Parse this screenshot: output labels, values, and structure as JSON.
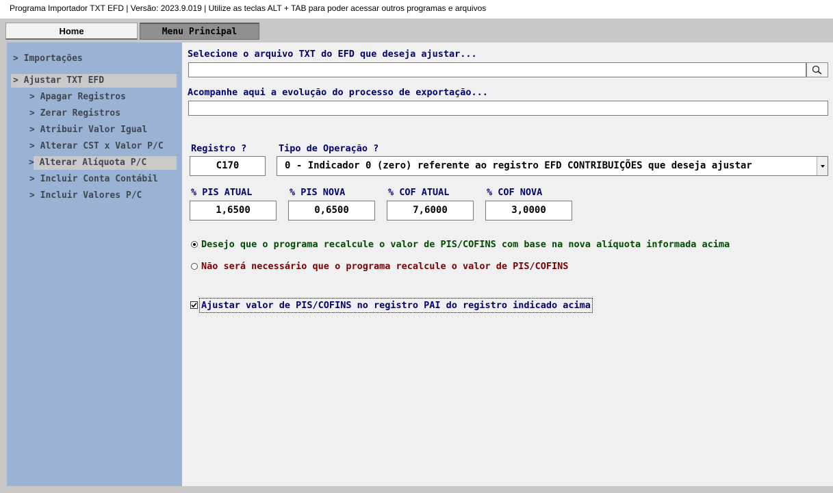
{
  "titlebar": {
    "text": "Programa Importador TXT EFD   |   Versão: 2023.9.019   |   Utilize as teclas ALT + TAB para poder acessar outros programas e arquivos"
  },
  "tabs": {
    "home": "Home",
    "menu": "Menu Principal"
  },
  "sidebar": {
    "items": [
      {
        "label": "> Importações",
        "highlighted": false
      },
      {
        "label": "> Ajustar TXT EFD",
        "highlighted": true
      },
      {
        "label": "> Apagar Registros",
        "highlighted": false
      },
      {
        "label": "> Zerar Registros",
        "highlighted": false
      },
      {
        "label": "> Atribuir Valor Igual",
        "highlighted": false
      },
      {
        "label": "> Alterar CST x Valor P/C",
        "highlighted": false
      },
      {
        "label": "> Alterar Alíquota P/C",
        "highlighted": true
      },
      {
        "label": "> Incluir Conta Contábil",
        "highlighted": false
      },
      {
        "label": "> Incluir Valores P/C",
        "highlighted": false
      }
    ]
  },
  "main": {
    "file_label": "Selecione o arquivo TXT do EFD que deseja ajustar...",
    "file_value": "",
    "progress_label": "Acompanhe aqui a evolução do processo de exportação...",
    "progress_value": "",
    "registro_label": "Registro ?",
    "registro_value": "C170",
    "tipo_label": "Tipo de Operação ?",
    "tipo_value": "0 - Indicador 0 (zero) referente ao registro EFD CONTRIBUIÇÕES que deseja ajustar",
    "pis_atual_label": "% PIS ATUAL",
    "pis_atual_value": "1,6500",
    "pis_nova_label": "% PIS NOVA",
    "pis_nova_value": "0,6500",
    "cof_atual_label": "% COF ATUAL",
    "cof_atual_value": "7,6000",
    "cof_nova_label": "% COF NOVA",
    "cof_nova_value": "3,0000",
    "radio_recalc_label": "Desejo que o programa recalcule o valor de PIS/COFINS com base na nova alíquota informada acima",
    "radio_recalc_selected": true,
    "radio_norecalc_label": "Não será necessário que o programa recalcule o valor de PIS/COFINS",
    "radio_norecalc_selected": false,
    "checkbox_label": "Ajustar valor de PIS/COFINS no registro PAI do registro indicado acima",
    "checkbox_checked": true
  },
  "icons": {
    "search": "magnifier-icon",
    "dropdown": "chevron-down-icon",
    "check": "checkmark-icon"
  },
  "colors": {
    "sidebar": "#9ab3d5",
    "label_blue": "#00006e",
    "option_green": "#004a00",
    "option_red": "#7a0000"
  }
}
